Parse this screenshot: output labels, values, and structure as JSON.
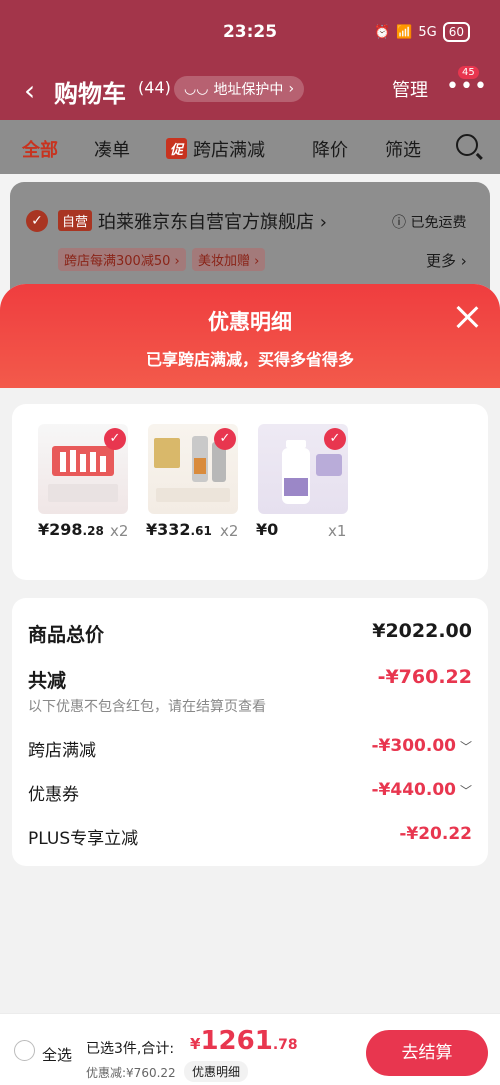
{
  "status_bar": {
    "time": "23:25",
    "network": "5G",
    "battery": "60"
  },
  "nav": {
    "title": "购物车",
    "count": "(44)",
    "address_pill": "地址保护中",
    "manage_label": "管理",
    "notification_count": "45"
  },
  "tabs": [
    {
      "label": "全部",
      "active": true
    },
    {
      "label": "凑单"
    },
    {
      "label": "跨店满减",
      "tag": "促"
    },
    {
      "label": "降价"
    },
    {
      "label": "筛选"
    }
  ],
  "store": {
    "tag": "自营",
    "name": "珀莱雅京东自营官方旗舰店",
    "shipping": "已免运费",
    "promos": [
      "跨店每满300减50",
      "美妆加赠"
    ],
    "more_label": "更多"
  },
  "sheet": {
    "title": "优惠明细",
    "subtitle": "已享跨店满减，买得多省得多",
    "products": [
      {
        "price_int": "¥298",
        "price_dec": ".28",
        "qty": "x2",
        "color": "#e85a5a"
      },
      {
        "price_int": "¥332",
        "price_dec": ".61",
        "qty": "x2",
        "color": "#d98b3c"
      },
      {
        "price_int": "¥0",
        "price_dec": "",
        "qty": "x1",
        "color": "#9b87c7"
      }
    ],
    "summary": {
      "total_label": "商品总价",
      "total_value": "¥2022.00",
      "reduce_label": "共减",
      "reduce_value": "-¥760.22",
      "note": "以下优惠不包含红包，请在结算页查看",
      "items": [
        {
          "label": "跨店满减",
          "value": "-¥300.00",
          "expandable": true
        },
        {
          "label": "优惠券",
          "value": "-¥440.00",
          "expandable": true
        },
        {
          "label": "PLUS专享立减",
          "value": "-¥20.22",
          "expandable": false
        }
      ]
    }
  },
  "bottom": {
    "select_all": "全选",
    "selected_text": "已选3件,合计:",
    "currency": "¥",
    "total_int": "1261",
    "total_dec": ".78",
    "discount_text": "优惠减:¥760.22",
    "detail_pill": "优惠明细",
    "checkout": "去结算"
  },
  "colors": {
    "accent": "#e8364f",
    "header_gradient_start": "#ef3d3f",
    "header_gradient_end": "#f35a4b"
  }
}
